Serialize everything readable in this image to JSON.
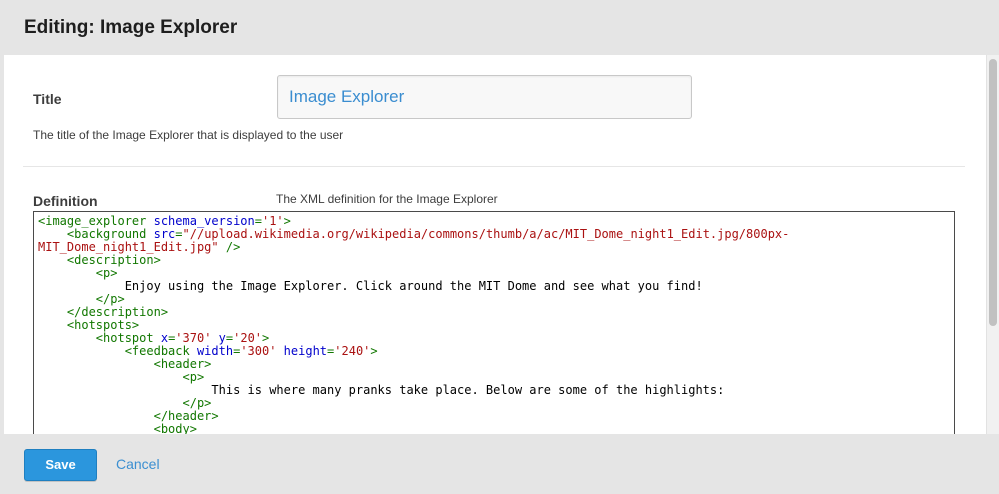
{
  "header": {
    "title": "Editing: Image Explorer"
  },
  "fields": {
    "title": {
      "label": "Title",
      "value": "Image Explorer",
      "help": "The title of the Image Explorer that is displayed to the user"
    },
    "definition": {
      "label": "Definition",
      "help": "The XML definition for the Image Explorer",
      "code_lines": [
        [
          [
            "tag",
            "<image_explorer "
          ],
          [
            "attr",
            "schema_version"
          ],
          [
            "tag",
            "="
          ],
          [
            "val",
            "'1'"
          ],
          [
            "tag",
            ">"
          ]
        ],
        [
          [
            "tag",
            "    <background "
          ],
          [
            "attr",
            "src"
          ],
          [
            "tag",
            "="
          ],
          [
            "val",
            "\"//upload.wikimedia.org/wikipedia/commons/thumb/a/ac/MIT_Dome_night1_Edit.jpg/800px-"
          ]
        ],
        [
          [
            "val",
            "MIT_Dome_night1_Edit.jpg\""
          ],
          [
            "tag",
            " />"
          ]
        ],
        [
          [
            "tag",
            "    <description>"
          ]
        ],
        [
          [
            "tag",
            "        <p>"
          ]
        ],
        [
          [
            "text",
            "            Enjoy using the Image Explorer. Click around the MIT Dome and see what you find!"
          ]
        ],
        [
          [
            "tag",
            "        </p>"
          ]
        ],
        [
          [
            "tag",
            "    </description>"
          ]
        ],
        [
          [
            "tag",
            "    <hotspots>"
          ]
        ],
        [
          [
            "tag",
            "        <hotspot "
          ],
          [
            "attr",
            "x"
          ],
          [
            "tag",
            "="
          ],
          [
            "val",
            "'370'"
          ],
          [
            "tag",
            " "
          ],
          [
            "attr",
            "y"
          ],
          [
            "tag",
            "="
          ],
          [
            "val",
            "'20'"
          ],
          [
            "tag",
            ">"
          ]
        ],
        [
          [
            "tag",
            "            <feedback "
          ],
          [
            "attr",
            "width"
          ],
          [
            "tag",
            "="
          ],
          [
            "val",
            "'300'"
          ],
          [
            "tag",
            " "
          ],
          [
            "attr",
            "height"
          ],
          [
            "tag",
            "="
          ],
          [
            "val",
            "'240'"
          ],
          [
            "tag",
            ">"
          ]
        ],
        [
          [
            "tag",
            "                <header>"
          ]
        ],
        [
          [
            "tag",
            "                    <p>"
          ]
        ],
        [
          [
            "text",
            "                        This is where many pranks take place. Below are some of the highlights:"
          ]
        ],
        [
          [
            "tag",
            "                    </p>"
          ]
        ],
        [
          [
            "tag",
            "                </header>"
          ]
        ],
        [
          [
            "tag",
            "                <body>"
          ]
        ]
      ]
    }
  },
  "footer": {
    "save_label": "Save",
    "cancel_label": "Cancel"
  },
  "colors": {
    "accent": "#2b96dd",
    "link": "#3b8fd1",
    "xml_tag": "#117700",
    "xml_attr": "#0000cc",
    "xml_value": "#aa1111"
  }
}
